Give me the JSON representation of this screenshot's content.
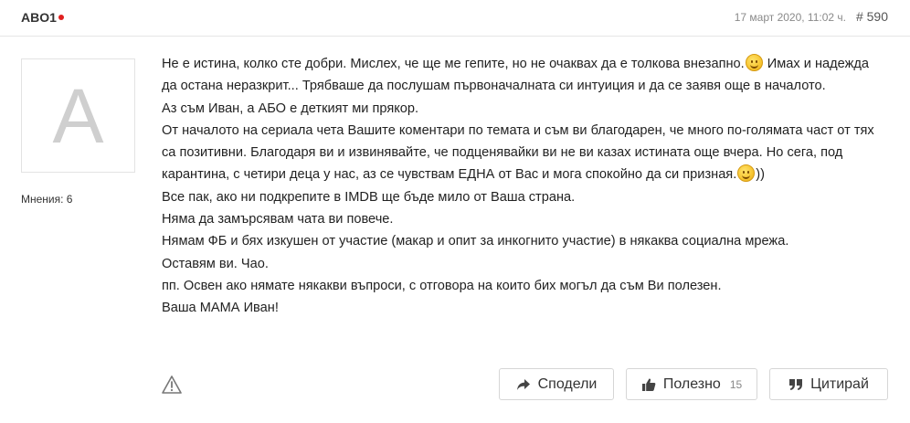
{
  "post": {
    "author": "ABO1",
    "date": "17 март 2020, 11:02 ч.",
    "number": "# 590",
    "avatar_letter": "A",
    "opinions": "Мнения: 6",
    "status_color": "#e0201f",
    "lines": [
      [
        "Не е истина, колко сте добри. Мислех, че ще ме гепите, но не очаквах да е толкова внезапно.",
        "smile-emoji",
        " Имах и надежда да остана неразкрит... Трябваше да послушам първоначалната си интуиция и да се заявя още в началото."
      ],
      "Аз съм Иван, а АБО е деткият ми прякор.",
      [
        "От началото на сериала чета Вашите коментари по темата и съм ви благодарен, че много по-голямата част от тях са позитивни. Благодаря ви и извинявайте, че подценявайки ви не ви казах истината още вчера. Но сега, под карантина, с четири деца у нас, аз се чувствам ЕДНА от Вас и мога спокойно да си призная.",
        "smile-emoji",
        "))"
      ],
      "Все пак, ако ни подкрепите в IMDB ще бъде мило от Ваша страна.",
      "Няма да замърсявам чата ви повече.",
      "Нямам ФБ и бях изкушен от участие (макар и опит за инкогнито участие) в някаква социална мрежа.",
      "Оставям ви. Чао.",
      "пп. Освен ако нямате някакви въпроси, с отговора на които бих могъл да съм Ви полезен.",
      "Ваша МАМА Иван!"
    ]
  },
  "actions": {
    "report_icon": "warning-icon",
    "share_label": "Сподели",
    "share_icon": "share-arrow-icon",
    "useful_label": "Полезно",
    "useful_count": "15",
    "useful_icon": "thumbs-up-icon",
    "quote_label": "Цитирай",
    "quote_icon": "quote-icon"
  }
}
